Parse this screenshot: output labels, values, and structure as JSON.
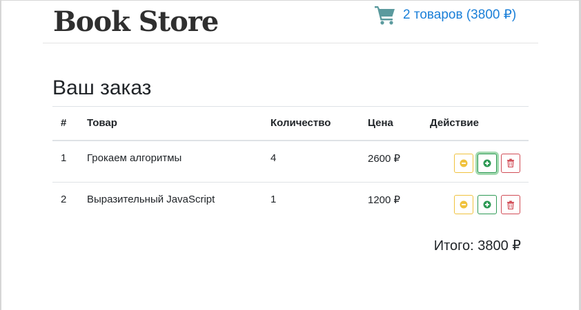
{
  "header": {
    "brand": "Book Store",
    "cart_summary": "2 товаров (3800 ₽)",
    "cart_icon": "shopping-cart-icon",
    "cart_color": "#5b9a9e",
    "link_color": "#1a7fd8"
  },
  "order": {
    "title": "Ваш заказ",
    "columns": [
      "#",
      "Товар",
      "Количество",
      "Цена",
      "Действие"
    ],
    "rows": [
      {
        "num": "1",
        "product": "Грокаем алгоритмы",
        "quantity": "4",
        "price": "2600 ₽"
      },
      {
        "num": "2",
        "product": "Выразительный JavaScript",
        "quantity": "1",
        "price": "1200 ₽"
      }
    ],
    "action_icons": [
      "minus-circle-icon",
      "plus-circle-icon",
      "trash-icon"
    ],
    "action_colors": {
      "minus": "#f0c23d",
      "plus": "#2e9a55",
      "delete": "#d14b55"
    },
    "total": "Итого: 3800 ₽"
  }
}
